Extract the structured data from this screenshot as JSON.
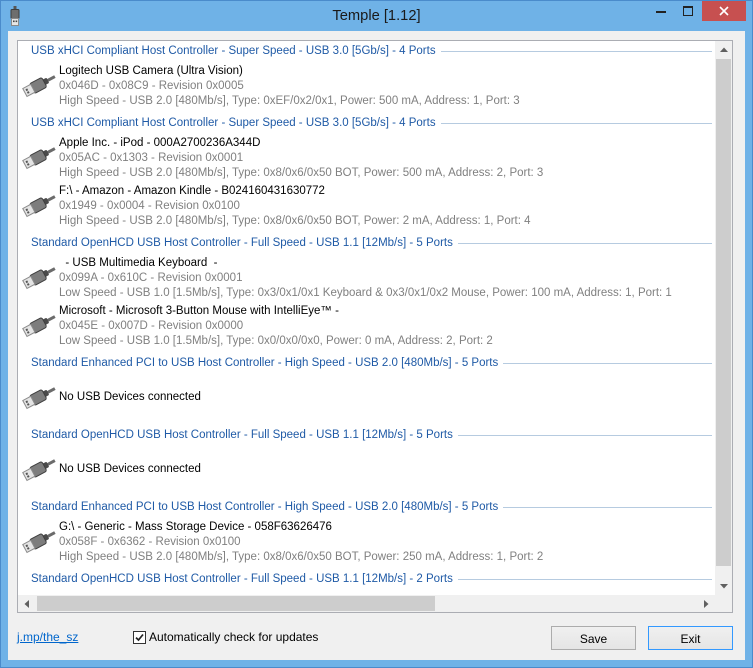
{
  "window": {
    "title": "Temple [1.12]",
    "app_icon": "usb-plug-icon",
    "caption_buttons": [
      "minimize-icon",
      "maximize-icon",
      "close-icon"
    ]
  },
  "colors": {
    "frame": "#6FB2E7",
    "close_button": "#C75050",
    "controller_header": "#1F5AA6",
    "secondary_text": "#808080",
    "link": "#0066CC",
    "default_button_border": "#3399FF"
  },
  "device_list": {
    "device_icon": "usb-plug-icon",
    "groups": [
      {
        "header": "USB xHCI Compliant Host Controller - Super Speed - USB 3.0 [5Gb/s] - 4 Ports",
        "devices": [
          {
            "name": "Logitech USB Camera (Ultra Vision)",
            "ids": "0x046D - 0x08C9 - Revision 0x0005",
            "details": "High Speed - USB 2.0 [480Mb/s], Type: 0xEF/0x2/0x1, Power: 500 mA, Address: 1, Port: 3"
          }
        ]
      },
      {
        "header": "USB xHCI Compliant Host Controller - Super Speed - USB 3.0 [5Gb/s] - 4 Ports",
        "devices": [
          {
            "name": "Apple Inc. - iPod - 000A2700236A344D",
            "ids": "0x05AC - 0x1303 - Revision 0x0001",
            "details": "High Speed - USB 2.0 [480Mb/s], Type: 0x8/0x6/0x50 BOT, Power: 500 mA, Address: 2, Port: 3"
          },
          {
            "name": "F:\\ - Amazon - Amazon Kindle - B024160431630772",
            "ids": "0x1949 - 0x0004 - Revision 0x0100",
            "details": "High Speed - USB 2.0 [480Mb/s], Type: 0x8/0x6/0x50 BOT, Power: 2 mA, Address: 1, Port: 4"
          }
        ]
      },
      {
        "header": "Standard OpenHCD USB Host Controller - Full Speed - USB 1.1 [12Mb/s] - 5 Ports",
        "devices": [
          {
            "name": "  - USB Multimedia Keyboard  -",
            "ids": "0x099A - 0x610C - Revision 0x0001",
            "details": "Low Speed - USB 1.0 [1.5Mb/s], Type: 0x3/0x1/0x1 Keyboard & 0x3/0x1/0x2 Mouse, Power: 100 mA, Address: 1, Port: 1"
          },
          {
            "name": "Microsoft - Microsoft 3-Button Mouse with IntelliEye™ -",
            "ids": "0x045E - 0x007D - Revision 0x0000",
            "details": "Low Speed - USB 1.0 [1.5Mb/s], Type: 0x0/0x0/0x0, Power: 0 mA, Address: 2, Port: 2"
          }
        ]
      },
      {
        "header": "Standard Enhanced PCI to USB Host Controller - High Speed - USB 2.0 [480Mb/s] - 5 Ports",
        "empty_text": "No USB Devices connected"
      },
      {
        "header": "Standard OpenHCD USB Host Controller - Full Speed - USB 1.1 [12Mb/s] - 5 Ports",
        "empty_text": "No USB Devices connected"
      },
      {
        "header": "Standard Enhanced PCI to USB Host Controller - High Speed - USB 2.0 [480Mb/s] - 5 Ports",
        "devices": [
          {
            "name": "G:\\ - Generic - Mass Storage Device - 058F63626476",
            "ids": "0x058F - 0x6362 - Revision 0x0100",
            "details": "High Speed - USB 2.0 [480Mb/s], Type: 0x8/0x6/0x50 BOT, Power: 250 mA, Address: 1, Port: 2"
          }
        ]
      },
      {
        "header": "Standard OpenHCD USB Host Controller - Full Speed - USB 1.1 [12Mb/s] - 2 Ports",
        "devices": []
      }
    ]
  },
  "footer": {
    "link_text": "j.mp/the_sz",
    "auto_update": {
      "label": "Automatically check for updates",
      "checked": true
    },
    "save_label": "Save",
    "exit_label": "Exit"
  }
}
